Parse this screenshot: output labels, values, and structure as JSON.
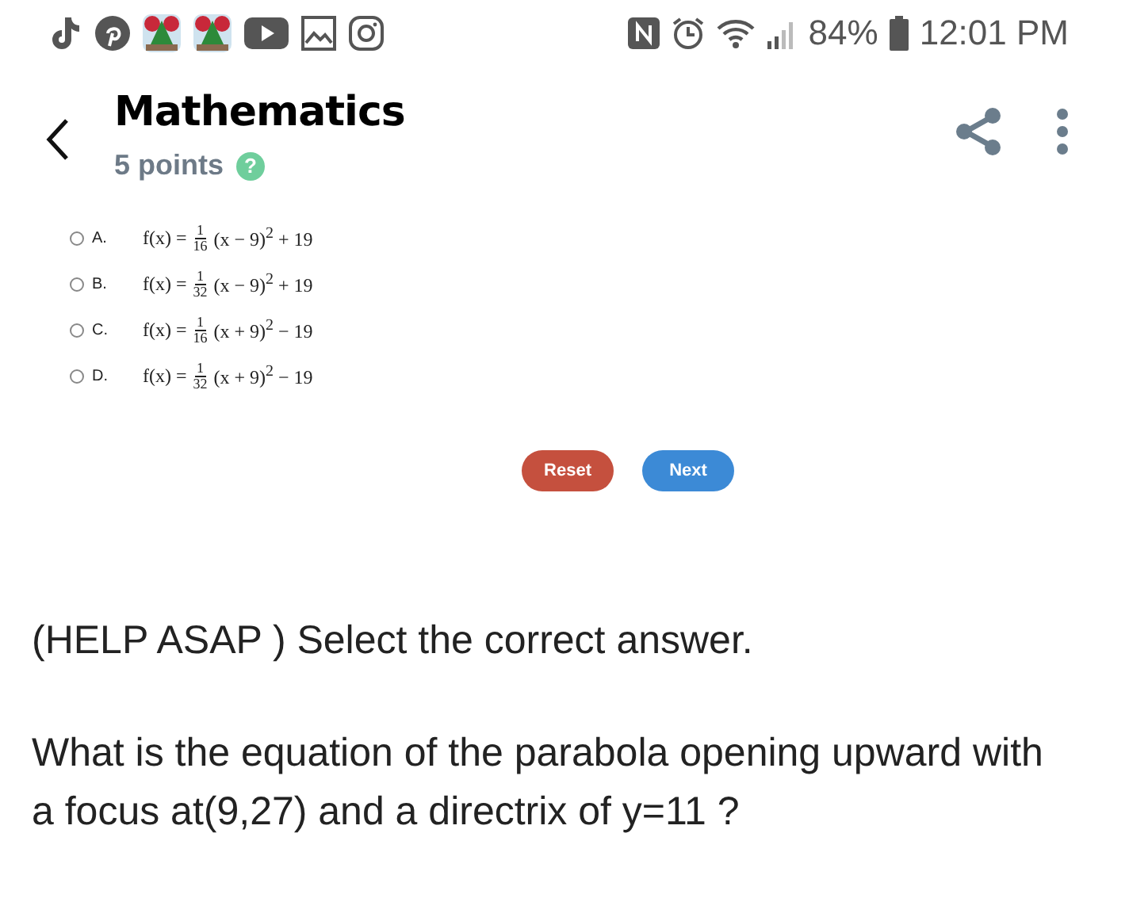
{
  "status_bar": {
    "battery": "84%",
    "time": "12:01 PM"
  },
  "header": {
    "title": "Mathematics",
    "points": "5 points",
    "help": "?"
  },
  "options": [
    {
      "letter": "A.",
      "selected": false,
      "lhs": "f(x) =",
      "num": "1",
      "den": "16",
      "rest": "(x − 9)$^{2}$ + 19"
    },
    {
      "letter": "B.",
      "selected": false,
      "lhs": "f(x) =",
      "num": "1",
      "den": "32",
      "rest": "(x − 9)$^{2}$ + 19"
    },
    {
      "letter": "C.",
      "selected": false,
      "lhs": "f(x) =",
      "num": "1",
      "den": "16",
      "rest": "(x + 9)$^{2}$ − 19"
    },
    {
      "letter": "D.",
      "selected": false,
      "lhs": "f(x) =",
      "num": "1",
      "den": "32",
      "rest": "(x + 9)$^{2}$ − 19"
    }
  ],
  "buttons": [
    {
      "label": "Reset",
      "kind": "reset"
    },
    {
      "label": "Next",
      "kind": "next"
    }
  ],
  "question": {
    "intro": "(HELP ASAP ) Select the correct answer.",
    "body": "What is the equation of the parabola opening upward with a focus at(9,27) and a directrix of y=11 ?"
  }
}
